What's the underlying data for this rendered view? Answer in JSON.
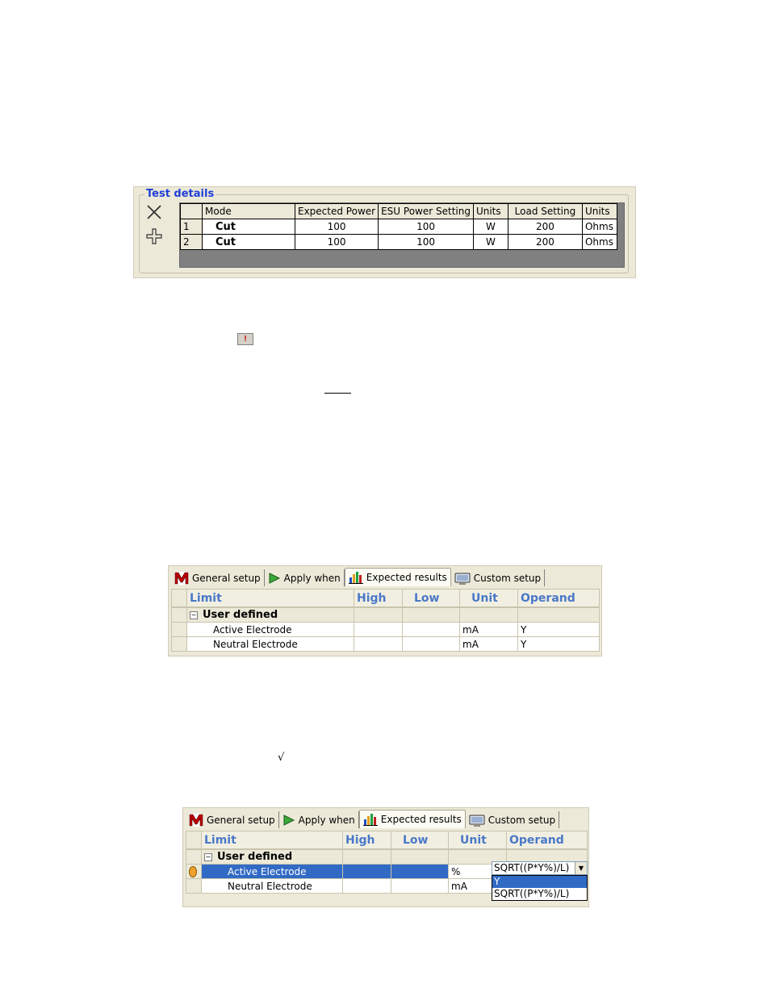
{
  "test_details": {
    "title": "Test details",
    "columns": [
      "",
      "Mode",
      "Expected Power",
      "ESU Power Setting",
      "Units",
      "Load Setting",
      "Units"
    ],
    "rows": [
      {
        "num": "1",
        "mode": "Cut",
        "expected_power": "100",
        "esu_power": "100",
        "units": "W",
        "load": "200",
        "load_units": "Ohms"
      },
      {
        "num": "2",
        "mode": "Cut",
        "expected_power": "100",
        "esu_power": "100",
        "units": "W",
        "load": "200",
        "load_units": "Ohms"
      }
    ],
    "icons": [
      "delete-icon",
      "add-icon"
    ]
  },
  "warning_icon_label": "!",
  "sqrt_symbol": "√",
  "tabs": [
    {
      "label": "General setup",
      "icon": "m-logo-icon"
    },
    {
      "label": "Apply when",
      "icon": "play-icon"
    },
    {
      "label": "Expected results",
      "icon": "bar-chart-icon"
    },
    {
      "label": "Custom setup",
      "icon": "monitor-icon"
    }
  ],
  "limits_panel_1": {
    "columns": [
      "Limit",
      "High",
      "Low",
      "Unit",
      "Operand"
    ],
    "group": "User defined",
    "rows": [
      {
        "limit": "Active Electrode",
        "high": "",
        "low": "",
        "unit": "mA",
        "operand": "Y"
      },
      {
        "limit": "Neutral Electrode",
        "high": "",
        "low": "",
        "unit": "mA",
        "operand": "Y"
      }
    ]
  },
  "limits_panel_2": {
    "columns": [
      "Limit",
      "High",
      "Low",
      "Unit",
      "Operand"
    ],
    "group": "User defined",
    "rows": [
      {
        "limit": "Active Electrode",
        "high": "",
        "low": "",
        "unit": "%",
        "operand": "SQRT((P*Y%)/L)"
      },
      {
        "limit": "Neutral Electrode",
        "high": "",
        "low": "",
        "unit": "mA",
        "operand": ""
      }
    ],
    "dropdown_options": [
      "Y",
      "SQRT((P*Y%)/L)"
    ],
    "selected_option": "Y"
  },
  "colors": {
    "selection": "#316ac5",
    "header_text": "#4a78c8",
    "title_text": "#1f3fd8"
  }
}
